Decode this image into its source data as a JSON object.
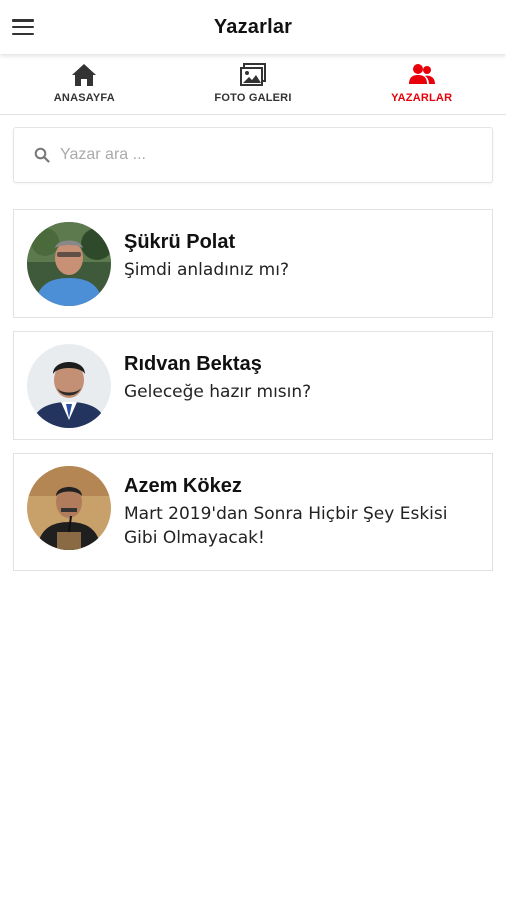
{
  "header": {
    "title": "Yazarlar"
  },
  "tabs": [
    {
      "label": "ANASAYFA",
      "icon": "home-icon",
      "active": false
    },
    {
      "label": "FOTO GALERI",
      "icon": "gallery-icon",
      "active": false
    },
    {
      "label": "YAZARLAR",
      "icon": "users-icon",
      "active": true
    }
  ],
  "colors": {
    "accent": "#e8000b",
    "text": "#111111",
    "border": "#e2e2e2"
  },
  "search": {
    "placeholder": "Yazar ara ..."
  },
  "authors": [
    {
      "name": "Şükrü Polat",
      "article": "Şimdi anladınız mı?"
    },
    {
      "name": "Rıdvan Bektaş",
      "article": "Geleceğe hazır mısın?"
    },
    {
      "name": "Azem Kökez",
      "article": "Mart 2019'dan Sonra Hiçbir Şey Eskisi Gibi Olmayacak!"
    }
  ]
}
